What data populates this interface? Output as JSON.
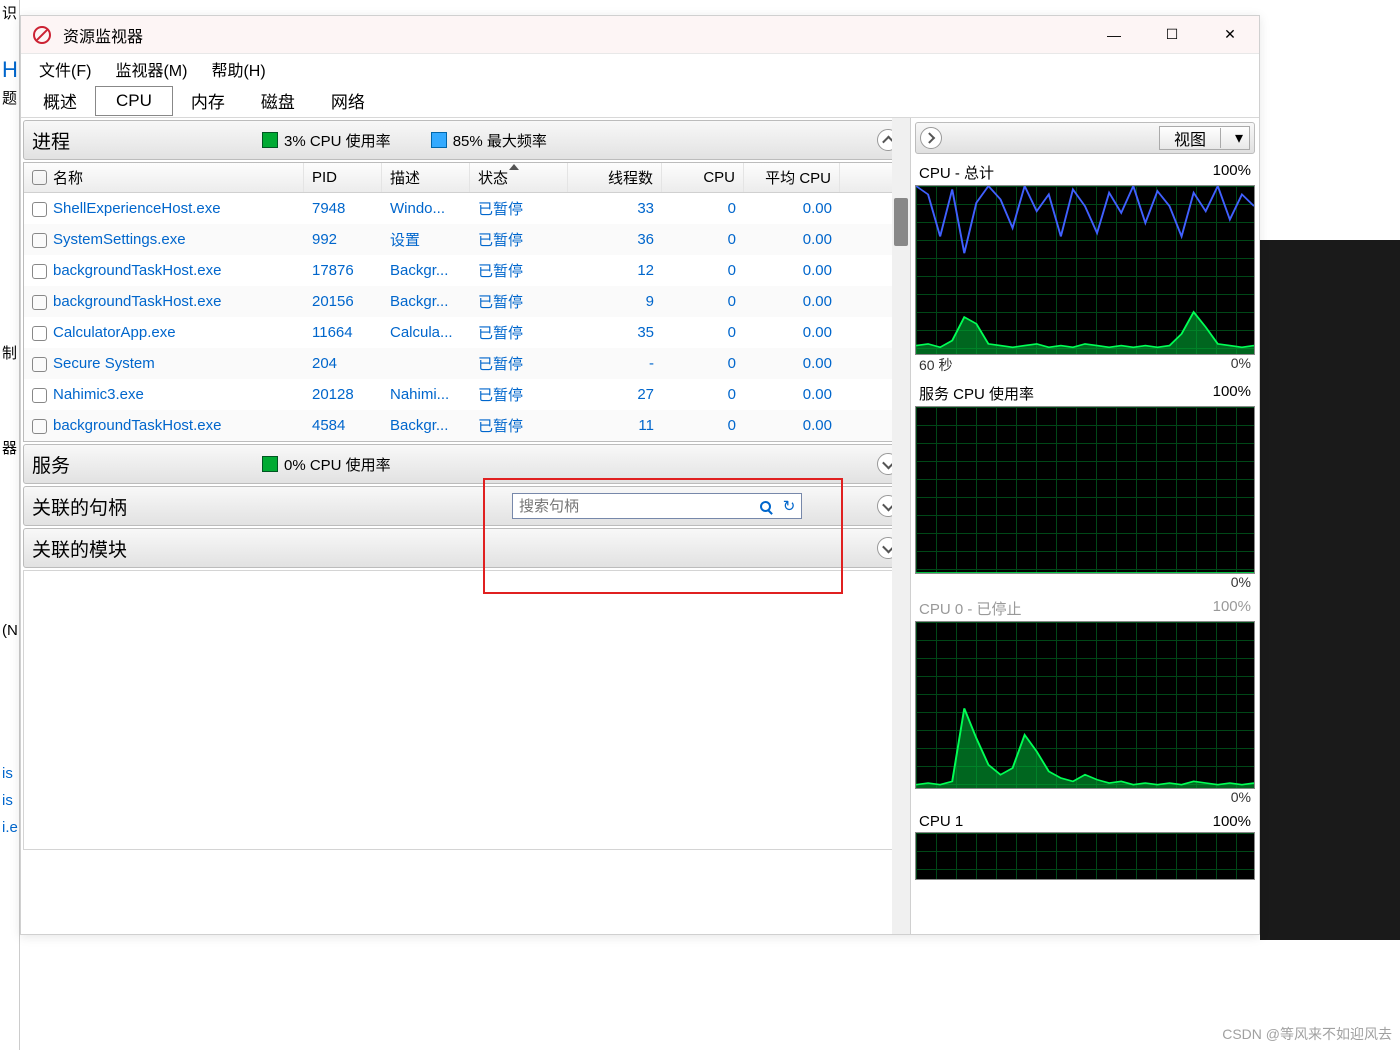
{
  "fragments": {
    "left1": "识",
    "left2": "H",
    "left3": "题",
    "left4": "制",
    "left5": "器",
    "left6": "(N",
    "links1": "is",
    "links2": "is",
    "links3": "i.e"
  },
  "window": {
    "title": "资源监视器",
    "controls": {
      "min": "—",
      "max": "☐",
      "close": "✕"
    }
  },
  "menu": {
    "file": "文件(F)",
    "monitor": "监视器(M)",
    "help": "帮助(H)"
  },
  "tabs": {
    "overview": "概述",
    "cpu": "CPU",
    "memory": "内存",
    "disk": "磁盘",
    "network": "网络"
  },
  "processes": {
    "title": "进程",
    "cpu_usage": "3% CPU 使用率",
    "max_freq": "85% 最大频率",
    "headers": {
      "name": "名称",
      "pid": "PID",
      "desc": "描述",
      "status": "状态",
      "threads": "线程数",
      "cpu": "CPU",
      "avg_cpu": "平均 CPU"
    },
    "rows": [
      {
        "name": "ShellExperienceHost.exe",
        "pid": "7948",
        "desc": "Windo...",
        "status": "已暂停",
        "threads": "33",
        "cpu": "0",
        "avg": "0.00"
      },
      {
        "name": "SystemSettings.exe",
        "pid": "992",
        "desc": "设置",
        "status": "已暂停",
        "threads": "36",
        "cpu": "0",
        "avg": "0.00"
      },
      {
        "name": "backgroundTaskHost.exe",
        "pid": "17876",
        "desc": "Backgr...",
        "status": "已暂停",
        "threads": "12",
        "cpu": "0",
        "avg": "0.00"
      },
      {
        "name": "backgroundTaskHost.exe",
        "pid": "20156",
        "desc": "Backgr...",
        "status": "已暂停",
        "threads": "9",
        "cpu": "0",
        "avg": "0.00"
      },
      {
        "name": "CalculatorApp.exe",
        "pid": "11664",
        "desc": "Calcula...",
        "status": "已暂停",
        "threads": "35",
        "cpu": "0",
        "avg": "0.00"
      },
      {
        "name": "Secure System",
        "pid": "204",
        "desc": "",
        "status": "已暂停",
        "threads": "-",
        "cpu": "0",
        "avg": "0.00"
      },
      {
        "name": "Nahimic3.exe",
        "pid": "20128",
        "desc": "Nahimi...",
        "status": "已暂停",
        "threads": "27",
        "cpu": "0",
        "avg": "0.00"
      },
      {
        "name": "backgroundTaskHost.exe",
        "pid": "4584",
        "desc": "Backgr...",
        "status": "已暂停",
        "threads": "11",
        "cpu": "0",
        "avg": "0.00"
      }
    ]
  },
  "services": {
    "title": "服务",
    "cpu_usage": "0% CPU 使用率"
  },
  "handles": {
    "title": "关联的句柄",
    "search_placeholder": "搜索句柄"
  },
  "modules": {
    "title": "关联的模块"
  },
  "right": {
    "view": "视图",
    "graphs": [
      {
        "title": "CPU - 总计",
        "max": "100%",
        "footer_left": "60 秒",
        "footer_right": "0%"
      },
      {
        "title": "服务 CPU 使用率",
        "max": "100%",
        "footer_left": "",
        "footer_right": "0%"
      },
      {
        "title": "CPU 0 - 已停止",
        "max": "100%",
        "footer_left": "",
        "footer_right": "0%"
      },
      {
        "title": "CPU 1",
        "max": "100%",
        "footer_left": "",
        "footer_right": ""
      }
    ]
  },
  "watermark": "CSDN @等风来不如迎风去",
  "chart_data": [
    {
      "type": "line",
      "title": "CPU - 总计",
      "ylim": [
        0,
        100
      ],
      "xlabel": "60 秒",
      "series": [
        {
          "name": "CPU使用率",
          "color": "#00ff55",
          "values": [
            5,
            6,
            4,
            8,
            22,
            18,
            6,
            5,
            4,
            5,
            6,
            4,
            5,
            4,
            6,
            5,
            4,
            5,
            4,
            5,
            4,
            5,
            12,
            25,
            16,
            6,
            5,
            4,
            5
          ]
        },
        {
          "name": "最大频率",
          "color": "#4060ff",
          "values": [
            100,
            95,
            70,
            98,
            60,
            90,
            100,
            92,
            75,
            100,
            85,
            95,
            70,
            98,
            88,
            72,
            96,
            84,
            100,
            78,
            97,
            88,
            70,
            96,
            85,
            100,
            80,
            95,
            88
          ]
        }
      ]
    },
    {
      "type": "line",
      "title": "服务 CPU 使用率",
      "ylim": [
        0,
        100
      ],
      "series": [
        {
          "name": "使用率",
          "color": "#00ff55",
          "values": [
            0,
            0,
            0,
            0,
            0,
            0,
            0,
            0,
            0,
            0,
            0,
            0,
            0,
            0,
            0,
            0,
            0,
            0,
            0,
            0,
            0,
            0,
            0,
            0,
            0,
            0,
            0,
            0,
            0
          ]
        }
      ]
    },
    {
      "type": "line",
      "title": "CPU 0 - 已停止",
      "ylim": [
        0,
        100
      ],
      "series": [
        {
          "name": "使用率",
          "color": "#00ff55",
          "values": [
            2,
            3,
            2,
            4,
            48,
            30,
            14,
            8,
            12,
            32,
            22,
            10,
            6,
            4,
            8,
            5,
            3,
            4,
            2,
            3,
            2,
            3,
            2,
            4,
            3,
            2,
            3,
            2,
            3
          ]
        }
      ]
    },
    {
      "type": "line",
      "title": "CPU 1",
      "ylim": [
        0,
        100
      ],
      "series": [
        {
          "name": "使用率",
          "color": "#00ff55",
          "values": []
        }
      ]
    }
  ]
}
